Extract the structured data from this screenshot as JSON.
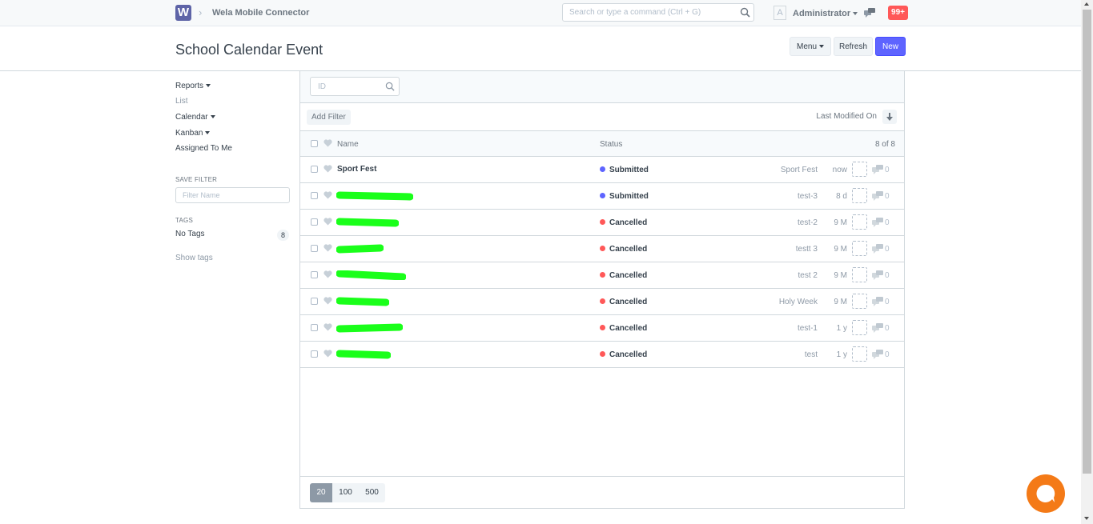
{
  "navbar": {
    "logo_letter": "W",
    "breadcrumb": "Wela Mobile Connector",
    "search_placeholder": "Search or type a command (Ctrl + G)",
    "avatar_letter": "A",
    "user": "Administrator",
    "notifications": "99+"
  },
  "page": {
    "title": "School Calendar Event",
    "menu_label": "Menu",
    "refresh_label": "Refresh",
    "new_label": "New"
  },
  "sidebar": {
    "reports": "Reports",
    "list": "List",
    "calendar": "Calendar",
    "kanban": "Kanban",
    "assigned": "Assigned To Me",
    "save_filter": "SAVE FILTER",
    "filter_placeholder": "Filter Name",
    "tags_label": "TAGS",
    "no_tags": "No Tags",
    "no_tags_count": "8",
    "show_tags": "Show tags"
  },
  "list": {
    "id_placeholder": "ID",
    "add_filter": "Add Filter",
    "sort_label": "Last Modified On",
    "col_name": "Name",
    "col_status": "Status",
    "count": "8 of 8",
    "rows": [
      {
        "name": "Sport Fest",
        "status": "Submitted",
        "title": "Sport Fest",
        "time": "now",
        "comments": "0"
      },
      {
        "name": "",
        "status": "Submitted",
        "title": "test-3",
        "time": "8 d",
        "comments": "0"
      },
      {
        "name": "",
        "status": "Cancelled",
        "title": "test-2",
        "time": "9 M",
        "comments": "0"
      },
      {
        "name": "",
        "status": "Cancelled",
        "title": "testt 3",
        "time": "9 M",
        "comments": "0"
      },
      {
        "name": "",
        "status": "Cancelled",
        "title": "test 2",
        "time": "9 M",
        "comments": "0"
      },
      {
        "name": "",
        "status": "Cancelled",
        "title": "Holy Week",
        "time": "9 M",
        "comments": "0"
      },
      {
        "name": "",
        "status": "Cancelled",
        "title": "test-1",
        "time": "1 y",
        "comments": "0"
      },
      {
        "name": "",
        "status": "Cancelled",
        "title": "test",
        "time": "1 y",
        "comments": "0"
      }
    ],
    "paging": [
      "20",
      "100",
      "500"
    ]
  },
  "colors": {
    "primary": "#5e64ff",
    "submitted": "#5e64ff",
    "cancelled": "#ff5858",
    "notification": "#ff5858",
    "chat_widget": "#f47a17",
    "redaction": "#1aff1a"
  }
}
